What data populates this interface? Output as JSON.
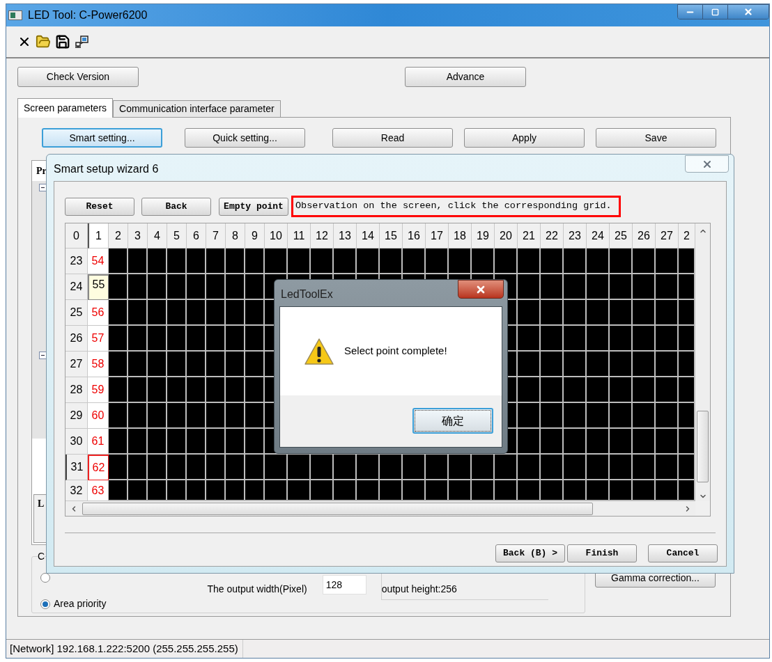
{
  "window": {
    "title": "LED Tool: C-Power6200"
  },
  "top_buttons": [
    "Check Version",
    "Advance"
  ],
  "tabs": [
    {
      "label": "Screen parameters",
      "selected": true
    },
    {
      "label": "Communication interface parameter",
      "selected": false
    }
  ],
  "action_buttons": [
    {
      "label": "Smart setting...",
      "focused": true
    },
    {
      "label": "Quick setting...",
      "focused": false
    },
    {
      "label": "Read",
      "focused": false
    },
    {
      "label": "Apply",
      "focused": false
    },
    {
      "label": "Save",
      "focused": false
    }
  ],
  "properties_panel": {
    "header": "Pr",
    "footer_label": "L"
  },
  "output_group": {
    "legend": "C",
    "radios": [
      {
        "selected": false
      },
      {
        "label": "Area priority",
        "selected": true
      }
    ],
    "width_label": "The output width(Pixel)",
    "width_value": "128",
    "height_text": "output height:256",
    "gamma_button": "Gamma correction..."
  },
  "status_bar": "[Network] 192.168.1.222:5200 (255.255.255.255)",
  "wizard": {
    "title": "Smart setup wizard 6",
    "tool_buttons": [
      "Reset",
      "Back",
      "Empty point"
    ],
    "instruction": "Observation on the screen, click the corresponding grid.",
    "grid": {
      "columns": [
        "0",
        "1",
        "2",
        "3",
        "4",
        "5",
        "6",
        "7",
        "8",
        "9",
        "10",
        "11",
        "12",
        "13",
        "14",
        "15",
        "16",
        "17",
        "18",
        "19",
        "20",
        "21",
        "22",
        "23",
        "24",
        "25",
        "26",
        "27",
        "2"
      ],
      "rows": [
        {
          "index": "23",
          "value": "54",
          "selected": false,
          "current": false
        },
        {
          "index": "24",
          "value": "55",
          "selected": true,
          "current": false
        },
        {
          "index": "25",
          "value": "56",
          "selected": false,
          "current": false
        },
        {
          "index": "26",
          "value": "57",
          "selected": false,
          "current": false
        },
        {
          "index": "27",
          "value": "58",
          "selected": false,
          "current": false
        },
        {
          "index": "28",
          "value": "59",
          "selected": false,
          "current": false
        },
        {
          "index": "29",
          "value": "60",
          "selected": false,
          "current": false
        },
        {
          "index": "30",
          "value": "61",
          "selected": false,
          "current": false
        },
        {
          "index": "31",
          "value": "62",
          "selected": false,
          "current": true
        },
        {
          "index": "32",
          "value": "63",
          "selected": false,
          "current": false
        }
      ]
    },
    "footer_buttons": [
      "Back (B) >",
      "Finish",
      "Cancel"
    ]
  },
  "message_box": {
    "title": "LedToolEx",
    "message": "Select point complete!",
    "button": "确定"
  }
}
